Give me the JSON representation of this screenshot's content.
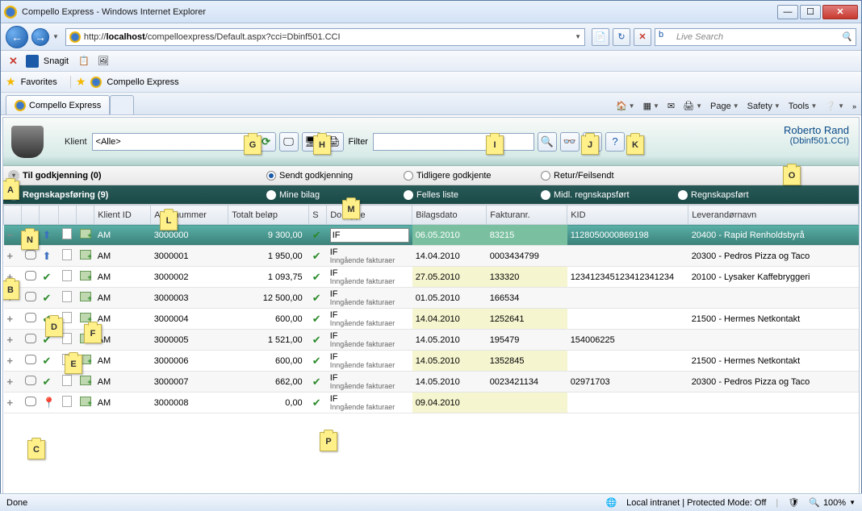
{
  "window": {
    "title": "Compello Express - Windows Internet Explorer"
  },
  "url": {
    "prefix": "http://",
    "host": "localhost",
    "path": "/compelloexpress/Default.aspx?cci=Dbinf501.CCI"
  },
  "search_placeholder": "Live Search",
  "snagit": "Snagit",
  "favorites": "Favorites",
  "tab_title": "Compello Express",
  "menu": {
    "page": "Page",
    "safety": "Safety",
    "tools": "Tools"
  },
  "user": {
    "name": "Roberto Rand",
    "db": "(Dbinf501.CCI)"
  },
  "toolbar": {
    "klient_label": "Klient",
    "klient_value": "<Alle>",
    "filter_label": "Filter"
  },
  "acc1": {
    "title": "Til godkjenning (0)",
    "opts": [
      "Sendt godkjenning",
      "Tidligere godkjente",
      "Retur/Feilsendt"
    ]
  },
  "acc2": {
    "title": "Regnskapsføring (9)",
    "opts": [
      "Mine bilag",
      "Felles liste",
      "Midl. regnskapsført",
      "Regnskapsført"
    ]
  },
  "cols": {
    "klient_id": "Klient ID",
    "arkiv": "Arkivnummer",
    "belop": "Totalt beløp",
    "s": "S",
    "doktype": "Dok.type",
    "bilagsdato": "Bilagsdato",
    "fakturanr": "Fakturanr.",
    "kid": "KID",
    "lev": "Leverandørnavn"
  },
  "doktype_sub": "Inngående fakturaer",
  "rows": [
    {
      "klient": "AM",
      "arkiv": "3000000",
      "belop": "9 300,00",
      "doktype": "IF",
      "dato": "06.05.2010",
      "fnr": "83215",
      "kid": "1128050000869198",
      "lev": "20400 - Rapid Renholdsbyrå"
    },
    {
      "klient": "AM",
      "arkiv": "3000001",
      "belop": "1 950,00",
      "doktype": "IF",
      "dato": "14.04.2010",
      "fnr": "0003434799",
      "kid": "",
      "lev": "20300 - Pedros Pizza og Taco"
    },
    {
      "klient": "AM",
      "arkiv": "3000002",
      "belop": "1 093,75",
      "doktype": "IF",
      "dato": "27.05.2010",
      "fnr": "133320",
      "kid": "123412345123412341234",
      "lev": "20100 - Lysaker Kaffebryggeri"
    },
    {
      "klient": "AM",
      "arkiv": "3000003",
      "belop": "12 500,00",
      "doktype": "IF",
      "dato": "01.05.2010",
      "fnr": "166534",
      "kid": "",
      "lev": ""
    },
    {
      "klient": "AM",
      "arkiv": "3000004",
      "belop": "600,00",
      "doktype": "IF",
      "dato": "14.04.2010",
      "fnr": "1252641",
      "kid": "",
      "lev": "21500 - Hermes Netkontakt"
    },
    {
      "klient": "AM",
      "arkiv": "3000005",
      "belop": "1 521,00",
      "doktype": "IF",
      "dato": "14.05.2010",
      "fnr": "195479",
      "kid": "154006225",
      "lev": ""
    },
    {
      "klient": "AM",
      "arkiv": "3000006",
      "belop": "600,00",
      "doktype": "IF",
      "dato": "14.05.2010",
      "fnr": "1352845",
      "kid": "",
      "lev": "21500 - Hermes Netkontakt"
    },
    {
      "klient": "AM",
      "arkiv": "3000007",
      "belop": "662,00",
      "doktype": "IF",
      "dato": "14.05.2010",
      "fnr": "0023421134",
      "kid": "02971703",
      "lev": "20300 - Pedros Pizza og Taco"
    },
    {
      "klient": "AM",
      "arkiv": "3000008",
      "belop": "0,00",
      "doktype": "IF",
      "dato": "09.04.2010",
      "fnr": "",
      "kid": "",
      "lev": ""
    }
  ],
  "status": {
    "done": "Done",
    "zone": "Local intranet | Protected Mode: Off",
    "zoom": "100%"
  },
  "callouts": {
    "A": "A",
    "B": "B",
    "C": "C",
    "D": "D",
    "E": "E",
    "F": "F",
    "G": "G",
    "H": "H",
    "I": "I",
    "J": "J",
    "K": "K",
    "L": "L",
    "M": "M",
    "N": "N",
    "O": "O",
    "P": "P"
  }
}
